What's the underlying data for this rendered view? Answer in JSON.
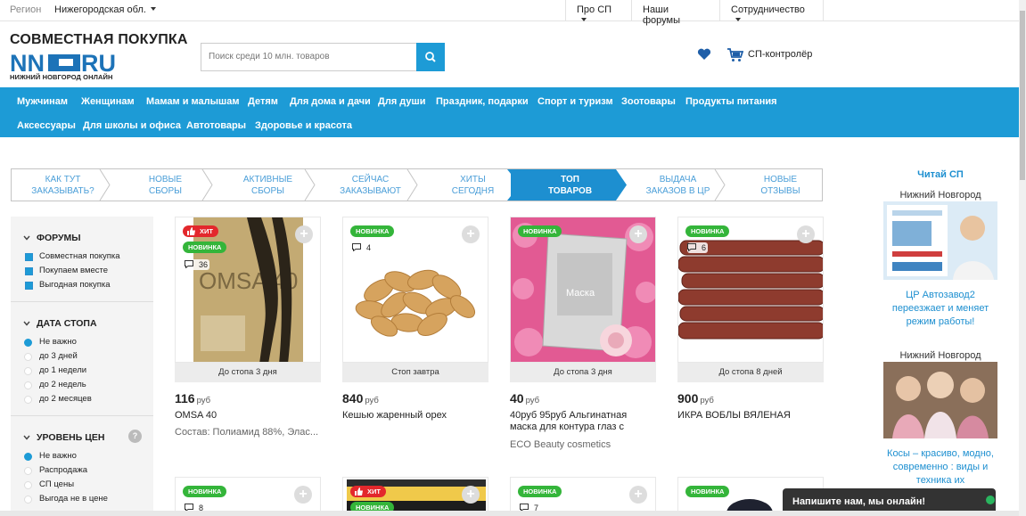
{
  "topbar": {
    "region_label": "Регион",
    "region_value": "Нижегородская обл.",
    "links": [
      "Про СП",
      "Наши форумы",
      "Сотрудничество"
    ]
  },
  "header": {
    "brand_title": "СОВМЕСТНАЯ ПОКУПКА",
    "logo_text_left": "NN",
    "logo_text_right": "RU",
    "logo_sub": "НИЖНИЙ НОВГОРОД ОНЛАЙН",
    "search_placeholder": "Поиск среди 10 млн. товаров",
    "cart_label": "СП-контролёр"
  },
  "categories": {
    "row1": [
      "Мужчинам",
      "Женщинам",
      "Мамам и малышам",
      "Детям",
      "Для дома и дачи",
      "Для души",
      "Праздник, подарки",
      "Спорт и туризм",
      "Зоотовары",
      "Продукты питания"
    ],
    "row2": [
      "Аксессуары",
      "Для школы и офиса",
      "Автотовары",
      "Здоровье и красота"
    ]
  },
  "steps": [
    {
      "l1": "Как тут",
      "l2": "заказывать?"
    },
    {
      "l1": "Новые",
      "l2": "сборы"
    },
    {
      "l1": "Активные",
      "l2": "сборы"
    },
    {
      "l1": "Сейчас",
      "l2": "заказывают"
    },
    {
      "l1": "Хиты",
      "l2": "сегодня"
    },
    {
      "l1": "Топ",
      "l2": "товаров"
    },
    {
      "l1": "Выдача",
      "l2": "заказов в ЦР"
    },
    {
      "l1": "Новые",
      "l2": "отзывы"
    }
  ],
  "sidebar": {
    "forums_title": "Форумы",
    "forums": [
      "Совместная покупка",
      "Покупаем вместе",
      "Выгодная покупка"
    ],
    "date_title": "Дата стопа",
    "dates": [
      "Не важно",
      "до 3 дней",
      "до 1 недели",
      "до 2 недель",
      "до 2 месяцев"
    ],
    "price_title": "Уровень цен",
    "prices": [
      "Не важно",
      "Распродажа",
      "СП цены",
      "Выгода не в цене"
    ]
  },
  "badges": {
    "new": "НОВИНКА",
    "hit": "ХИТ"
  },
  "currency": "руб",
  "products": [
    {
      "comments": "36",
      "stop": "До стопа 3 дня",
      "price": "116",
      "name": "OMSA 40",
      "desc": "Состав: Полиамид 88%, Элас..."
    },
    {
      "comments": "4",
      "stop": "Стоп завтра",
      "price": "840",
      "name": "Кешью жаренный орех",
      "desc": ""
    },
    {
      "comments": "",
      "stop": "До стопа 3 дня",
      "price": "40",
      "name": "40руб 95руб Альгинатная маска для контура глаз с",
      "desc": "ECO Beauty cosmetics",
      "pack_label": "Маска"
    },
    {
      "comments": "6",
      "stop": "До стопа 8 дней",
      "price": "900",
      "name": "ИКРА ВОБЛЫ ВЯЛЕНАЯ",
      "desc": ""
    },
    {
      "comments": "8"
    },
    {
      "comments": ""
    },
    {
      "comments": "7"
    },
    {
      "comments": ""
    }
  ],
  "right": {
    "title": "Читай СП",
    "city1": "Нижний Новгород",
    "link1": "ЦР Автозавод2 переезжает и меняет режим работы!",
    "city2": "Нижний Новгород",
    "link2": "Косы – красиво, модно, современно : виды и техника их"
  },
  "chat": {
    "label": "Напишите нам, мы онлайн!"
  },
  "colors": {
    "accent": "#1d9bd6",
    "badge_new": "#34b53a",
    "badge_hit": "#e3282c"
  }
}
